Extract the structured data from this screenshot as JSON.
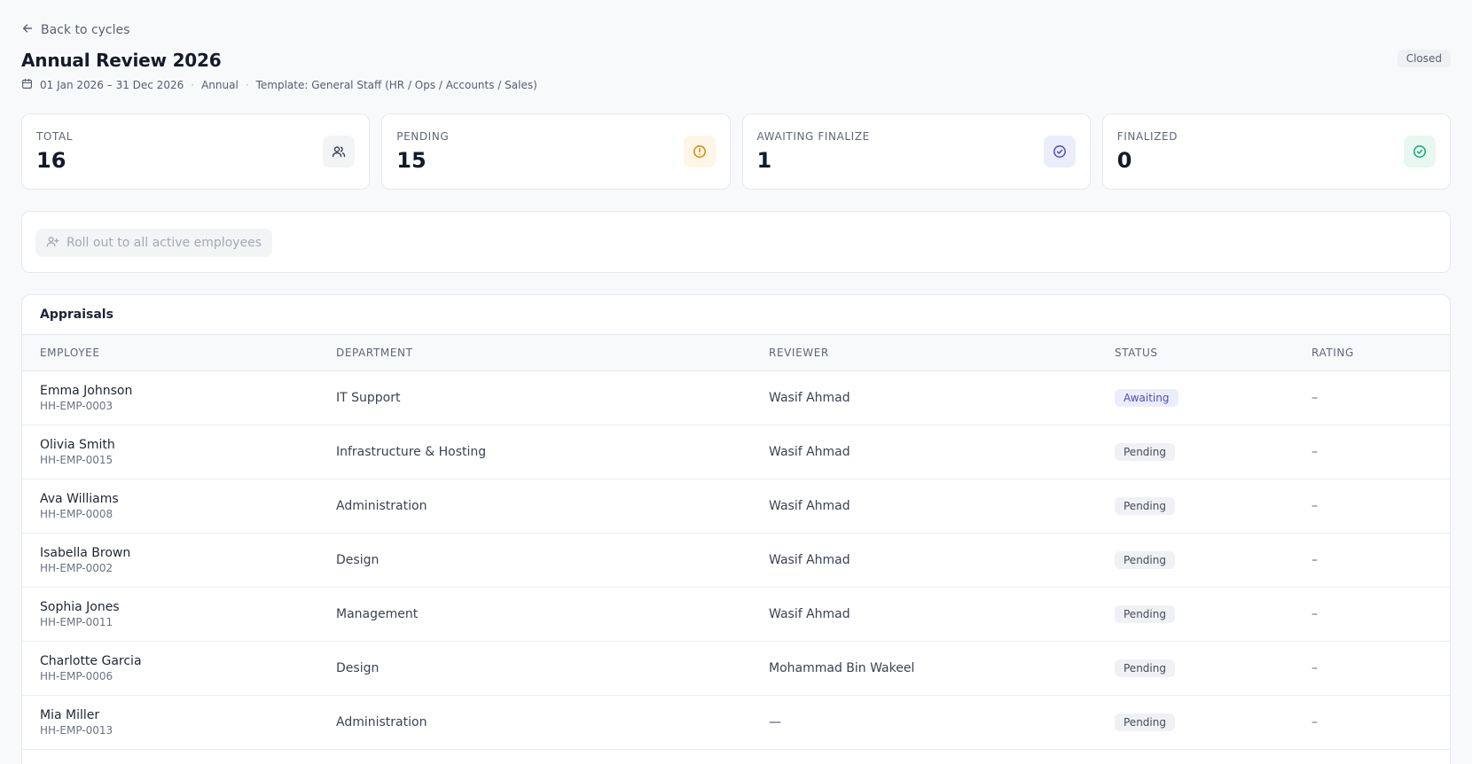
{
  "back_link": {
    "label": "Back to cycles"
  },
  "cycle": {
    "title": "Annual Review 2026",
    "status": "Closed",
    "date_range": "01 Jan 2026 – 31 Dec 2026",
    "frequency": "Annual",
    "template": "Template: General Staff (HR / Ops / Accounts / Sales)"
  },
  "stats": [
    {
      "label": "TOTAL",
      "value": "16",
      "icon": "users-icon",
      "color": "#3b4251",
      "bg": "#f3f4f6"
    },
    {
      "label": "PENDING",
      "value": "15",
      "icon": "alert-circle-icon",
      "color": "#d4890b",
      "bg": "#fdf6e7"
    },
    {
      "label": "AWAITING FINALIZE",
      "value": "1",
      "icon": "check-circle-icon",
      "color": "#4a4fc7",
      "bg": "#ecedfb"
    },
    {
      "label": "FINALIZED",
      "value": "0",
      "icon": "check-circle-icon",
      "color": "#17a673",
      "bg": "#e8f7f0"
    }
  ],
  "rollout": {
    "label": "Roll out to all active employees",
    "icon": "user-plus-icon"
  },
  "table": {
    "title": "Appraisals",
    "columns": [
      "EMPLOYEE",
      "DEPARTMENT",
      "REVIEWER",
      "STATUS",
      "RATING"
    ],
    "rows": [
      {
        "name": "Emma Johnson",
        "id": "HH-EMP-0003",
        "department": "IT Support",
        "reviewer": "Wasif Ahmad",
        "status": "Awaiting",
        "status_kind": "awaiting",
        "rating": "–"
      },
      {
        "name": "Olivia Smith",
        "id": "HH-EMP-0015",
        "department": "Infrastructure & Hosting",
        "reviewer": "Wasif Ahmad",
        "status": "Pending",
        "status_kind": "pending",
        "rating": "–"
      },
      {
        "name": "Ava Williams",
        "id": "HH-EMP-0008",
        "department": "Administration",
        "reviewer": "Wasif Ahmad",
        "status": "Pending",
        "status_kind": "pending",
        "rating": "–"
      },
      {
        "name": "Isabella Brown",
        "id": "HH-EMP-0002",
        "department": "Design",
        "reviewer": "Wasif Ahmad",
        "status": "Pending",
        "status_kind": "pending",
        "rating": "–"
      },
      {
        "name": "Sophia Jones",
        "id": "HH-EMP-0011",
        "department": "Management",
        "reviewer": "Wasif Ahmad",
        "status": "Pending",
        "status_kind": "pending",
        "rating": "–"
      },
      {
        "name": "Charlotte Garcia",
        "id": "HH-EMP-0006",
        "department": "Design",
        "reviewer": "Mohammad Bin Wakeel",
        "status": "Pending",
        "status_kind": "pending",
        "rating": "–"
      },
      {
        "name": "Mia Miller",
        "id": "HH-EMP-0013",
        "department": "Administration",
        "reviewer": "—",
        "status": "Pending",
        "status_kind": "pending",
        "rating": "–"
      }
    ]
  }
}
